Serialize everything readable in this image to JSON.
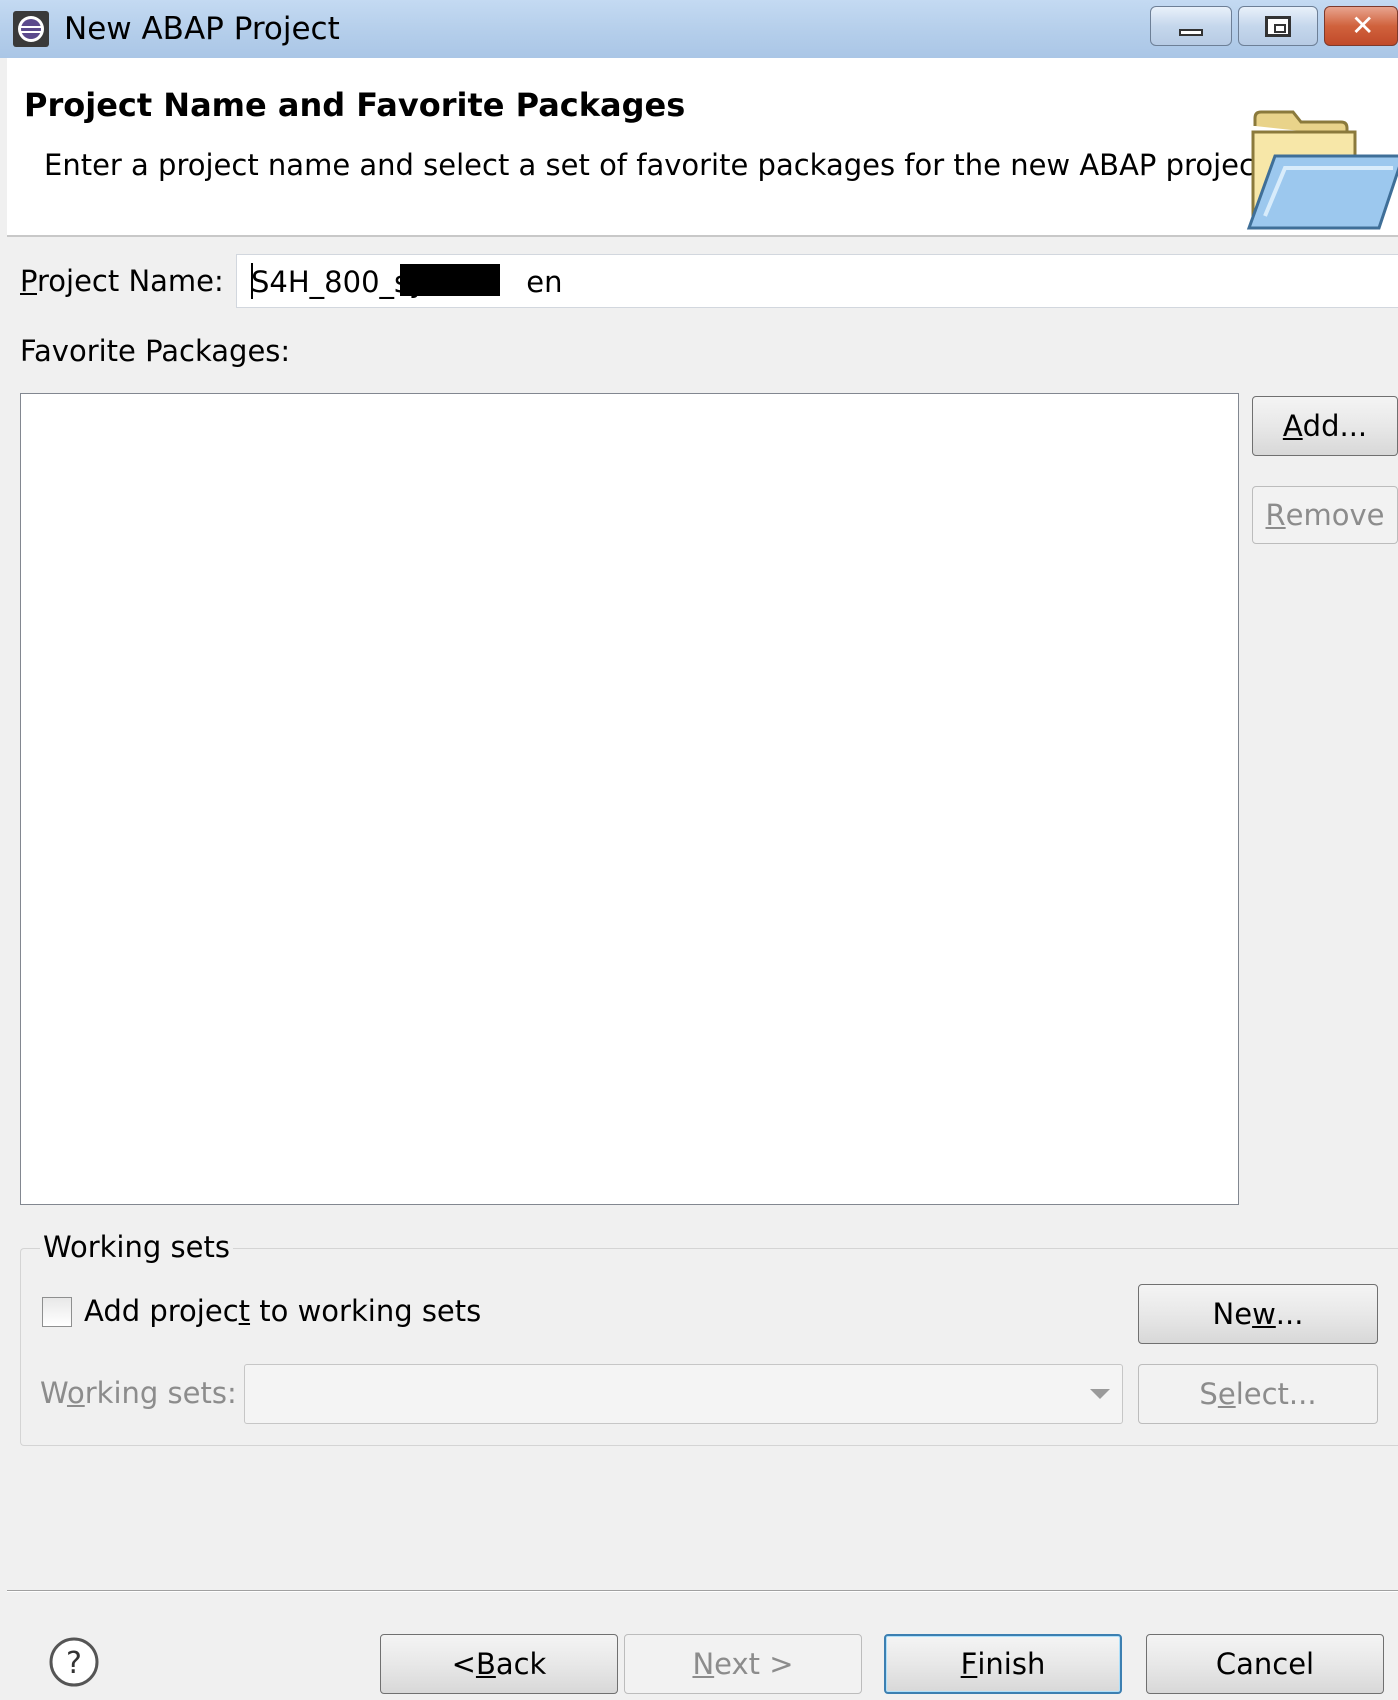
{
  "window": {
    "title": "New ABAP Project",
    "close_glyph": "✕"
  },
  "header": {
    "title": "Project Name and Favorite Packages",
    "description": "Enter a project name and select a set of favorite packages for the new ABAP project"
  },
  "project_name": {
    "label_mnemonic": "P",
    "label_rest": "roject Name:",
    "value_prefix": "S4H_800_sy",
    "value_suffix": "en"
  },
  "favorites": {
    "label": "Favorite Packages:",
    "items": []
  },
  "buttons": {
    "add_mn": "A",
    "add_rest": "dd...",
    "remove_mn": "R",
    "remove_rest": "emove"
  },
  "working_sets": {
    "group_label": "Working sets",
    "checkbox_pre": "Add projec",
    "checkbox_mn": "t",
    "checkbox_post": " to working sets",
    "checked": false,
    "new_pre": "Ne",
    "new_mn": "w",
    "new_post": "...",
    "sets_pre": "W",
    "sets_mn": "o",
    "sets_post": "rking sets:",
    "select_pre": "S",
    "select_mn": "e",
    "select_post": "lect...",
    "combo_value": ""
  },
  "footer": {
    "help_glyph": "?",
    "back_pre": "< ",
    "back_mn": "B",
    "back_post": "ack",
    "next_mn": "N",
    "next_post": "ext >",
    "finish_mn": "F",
    "finish_post": "inish",
    "cancel": "Cancel"
  }
}
